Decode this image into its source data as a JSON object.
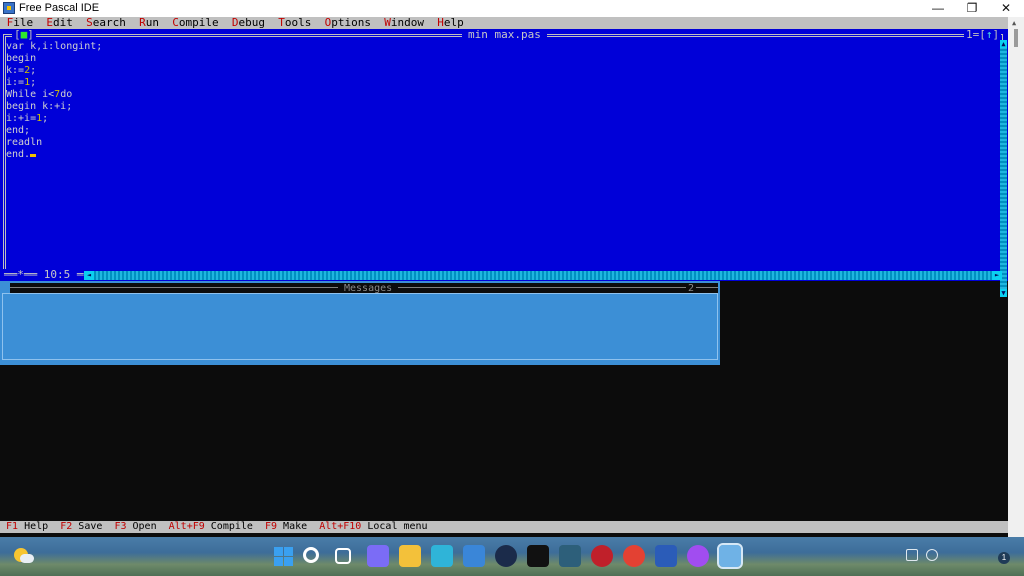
{
  "window": {
    "title": "Free Pascal IDE",
    "controls": {
      "minimize": "—",
      "restore": "❐",
      "close": "✕"
    }
  },
  "menu": [
    {
      "hotkey": "F",
      "rest": "ile"
    },
    {
      "hotkey": "E",
      "rest": "dit"
    },
    {
      "hotkey": "S",
      "rest": "earch"
    },
    {
      "hotkey": "R",
      "rest": "un"
    },
    {
      "hotkey": "C",
      "rest": "ompile"
    },
    {
      "hotkey": "D",
      "rest": "ebug"
    },
    {
      "hotkey": "T",
      "rest": "ools"
    },
    {
      "hotkey": "O",
      "rest": "ptions"
    },
    {
      "hotkey": "W",
      "rest": "indow"
    },
    {
      "hotkey": "H",
      "rest": "elp"
    }
  ],
  "editor": {
    "filename": "min max.pas",
    "close_box": "[■]",
    "window_number": "1=[",
    "zoom_glyph": "↑",
    "window_number_close": "]",
    "cursor_position": "10:5",
    "modified_marker": "*",
    "code_lines": [
      [
        {
          "t": "var k,i:longint;"
        }
      ],
      [
        {
          "t": "begin"
        }
      ],
      [
        {
          "t": "k:="
        },
        {
          "t": "2",
          "num": true
        },
        {
          "t": ";"
        }
      ],
      [
        {
          "t": "i:="
        },
        {
          "t": "1",
          "num": true
        },
        {
          "t": ";"
        }
      ],
      [
        {
          "t": "While i<"
        },
        {
          "t": "7",
          "num": true
        },
        {
          "t": "do"
        }
      ],
      [
        {
          "t": "begin k:+i;"
        }
      ],
      [
        {
          "t": "i:+i="
        },
        {
          "t": "1",
          "num": true
        },
        {
          "t": ";"
        }
      ],
      [
        {
          "t": "end;"
        }
      ],
      [
        {
          "t": "readln"
        }
      ],
      [
        {
          "t": "end."
        }
      ]
    ]
  },
  "messages": {
    "title": "Messages",
    "window_number": "2"
  },
  "keybar": [
    {
      "key": "F1",
      "label": "Help"
    },
    {
      "key": "F2",
      "label": "Save"
    },
    {
      "key": "F3",
      "label": "Open"
    },
    {
      "key": "Alt+F9",
      "label": "Compile"
    },
    {
      "key": "F9",
      "label": "Make"
    },
    {
      "key": "Alt+F10",
      "label": "Local menu"
    }
  ],
  "taskbar": {
    "apps": [
      {
        "name": "search-icon",
        "color": "#ffffff"
      },
      {
        "name": "task-view-icon",
        "color": "#ffffff"
      },
      {
        "name": "chat-icon",
        "color": "#7b6cf6"
      },
      {
        "name": "file-explorer-icon",
        "color": "#f3c13a"
      },
      {
        "name": "edge-icon",
        "color": "#2fb4d8"
      },
      {
        "name": "store-icon",
        "color": "#3a86d8"
      },
      {
        "name": "c-app-icon",
        "color": "#1b2b4a"
      },
      {
        "name": "tiktok-icon",
        "color": "#111111"
      },
      {
        "name": "install-app-icon",
        "color": "#2d5f7a"
      },
      {
        "name": "record-app-icon",
        "color": "#c0202a"
      },
      {
        "name": "chrome-icon",
        "color": "#e34133"
      },
      {
        "name": "word-icon",
        "color": "#2b5cb8"
      },
      {
        "name": "messenger-icon",
        "color": "#a14df0"
      },
      {
        "name": "free-pascal-icon",
        "color": "#6fb2e6"
      }
    ],
    "notification_count": "1"
  }
}
